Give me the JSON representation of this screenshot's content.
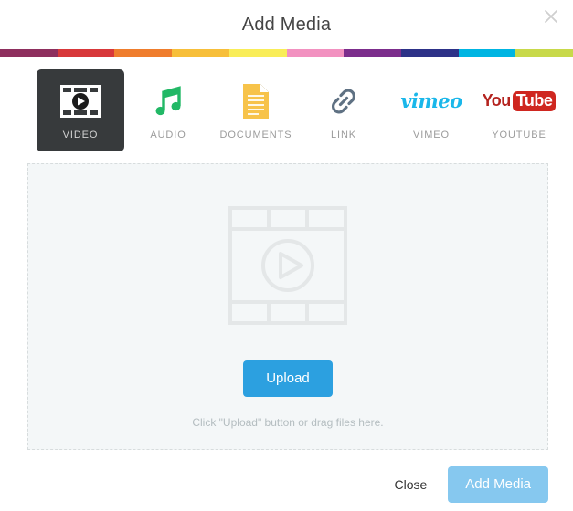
{
  "modal": {
    "title": "Add Media",
    "close_icon": "close-icon"
  },
  "stripe_colors": [
    "#8e2f5e",
    "#d8383a",
    "#ef7d2d",
    "#f7bf3a",
    "#f9ed58",
    "#f291c0",
    "#7c2d8c",
    "#2d3288",
    "#00b5e2",
    "#c8d94a"
  ],
  "tabs": [
    {
      "label": "VIDEO",
      "icon": "film-play-icon",
      "active": true
    },
    {
      "label": "AUDIO",
      "icon": "music-note-icon",
      "active": false
    },
    {
      "label": "DOCUMENTS",
      "icon": "document-icon",
      "active": false
    },
    {
      "label": "LINK",
      "icon": "chain-link-icon",
      "active": false
    },
    {
      "label": "VIMEO",
      "icon": "vimeo-logo",
      "active": false,
      "wordmark": "vimeo"
    },
    {
      "label": "YOUTUBE",
      "icon": "youtube-logo",
      "active": false,
      "wordmark_you": "You",
      "wordmark_tube": "Tube"
    }
  ],
  "dropzone": {
    "placeholder_icon": "film-strip-placeholder-icon",
    "upload_label": "Upload",
    "hint": "Click \"Upload\" button or drag files here."
  },
  "footer": {
    "close_label": "Close",
    "submit_label": "Add Media"
  },
  "colors": {
    "accent_blue": "#2ca0e0",
    "accent_blue_disabled": "#86c8ef",
    "active_tab_bg": "#373a3c",
    "dropzone_bg": "#f4f7f8",
    "dropzone_border": "#d7dcdd"
  }
}
